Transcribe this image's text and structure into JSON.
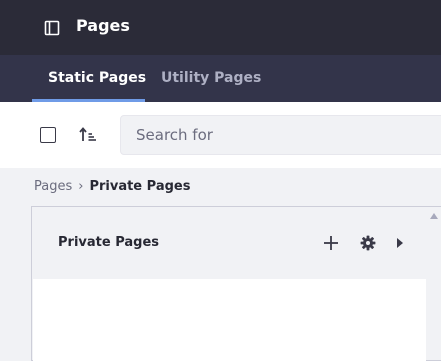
{
  "header": {
    "title": "Pages",
    "panel_icon": "sidebar-panel-icon"
  },
  "tabs": [
    {
      "label": "Static Pages",
      "active": true
    },
    {
      "label": "Utility Pages",
      "active": false
    }
  ],
  "toolbar": {
    "checkbox_checked": false,
    "sort_icon": "sort-ascending-icon",
    "search_placeholder": "Search for",
    "search_value": ""
  },
  "breadcrumb": {
    "items": [
      "Pages",
      "Private Pages"
    ],
    "separator": "›"
  },
  "column": {
    "title": "Private Pages",
    "actions": [
      "plus-icon",
      "gear-icon",
      "chevron-right-icon"
    ]
  },
  "colors": {
    "header_bg": "#2b2b38",
    "tabs_bg": "#33344a",
    "accent": "#6f9be7",
    "page_bg": "#f1f2f5"
  }
}
